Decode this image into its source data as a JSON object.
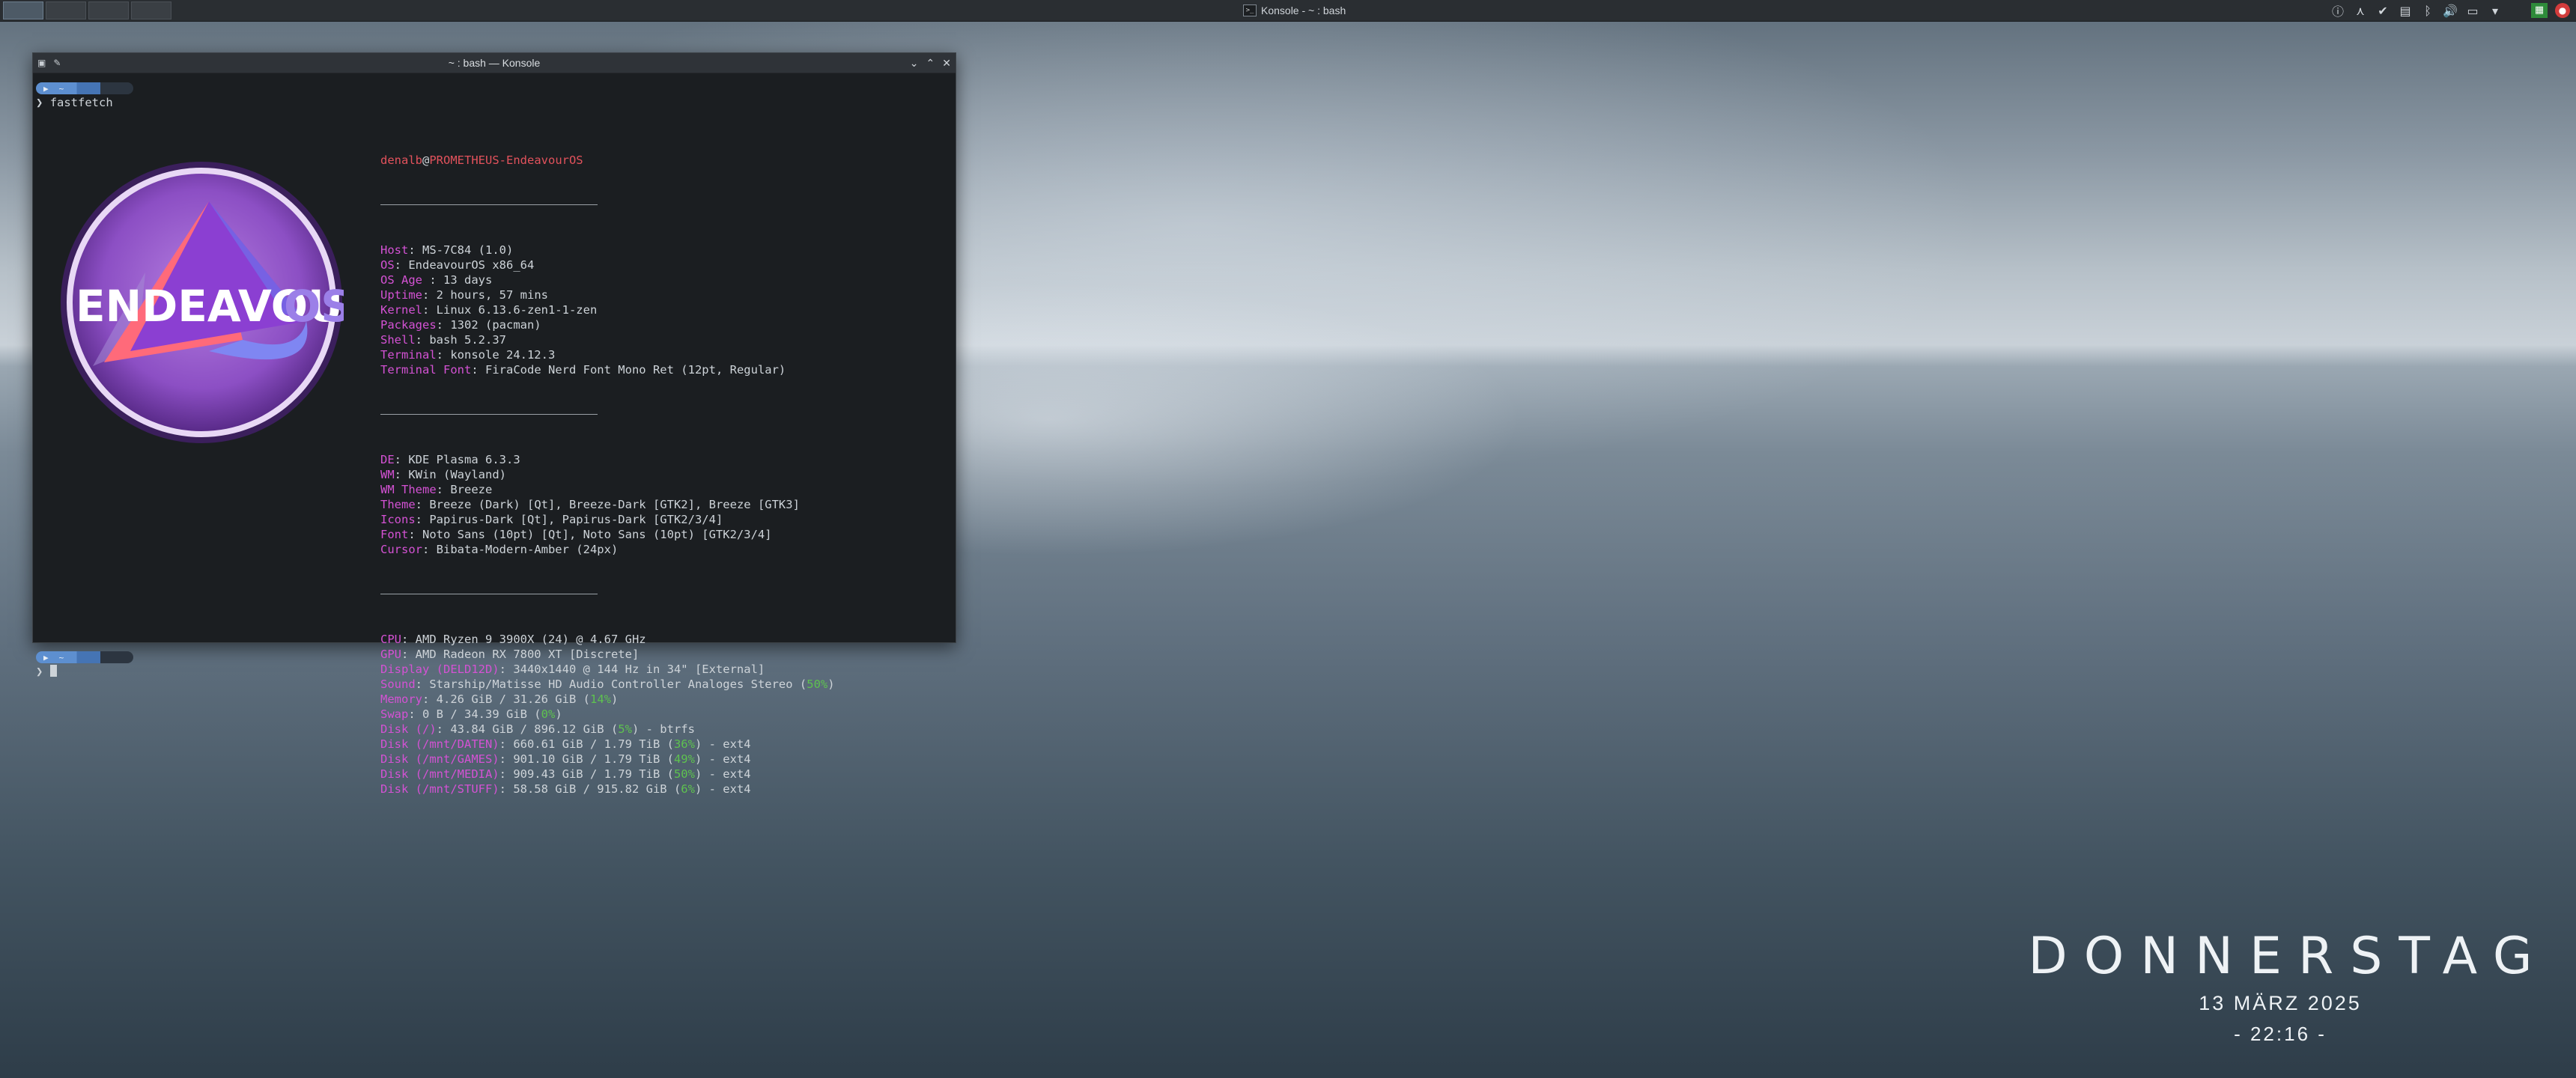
{
  "panel": {
    "task_title": "Konsole - ~ : bash",
    "task_icon": ">_"
  },
  "window": {
    "title": "~ : bash — Konsole",
    "min_icon": "⌄",
    "max_icon": "⌃",
    "close_icon": "✕"
  },
  "terminal": {
    "prompt_home": "~",
    "prompt_symbol": "❯",
    "command": "fastfetch",
    "logo_text_main": "ENDEAVOUR",
    "logo_text_os": "OS"
  },
  "fastfetch": {
    "user": "denalb",
    "at": "@",
    "host": "PROMETHEUS-EndeavourOS",
    "group1": [
      {
        "key": "Host",
        "value": "MS-7C84 (1.0)"
      },
      {
        "key": "OS",
        "value": "EndeavourOS x86_64"
      },
      {
        "key": "OS Age ",
        "value": "13 days"
      },
      {
        "key": "Uptime",
        "value": "2 hours, 57 mins"
      },
      {
        "key": "Kernel",
        "value": "Linux 6.13.6-zen1-1-zen"
      },
      {
        "key": "Packages",
        "value": "1302 (pacman)"
      },
      {
        "key": "Shell",
        "value": "bash 5.2.37"
      },
      {
        "key": "Terminal",
        "value": "konsole 24.12.3"
      },
      {
        "key": "Terminal Font",
        "value": "FiraCode Nerd Font Mono Ret (12pt, Regular)"
      }
    ],
    "group2": [
      {
        "key": "DE",
        "value": "KDE Plasma 6.3.3"
      },
      {
        "key": "WM",
        "value": "KWin (Wayland)"
      },
      {
        "key": "WM Theme",
        "value": "Breeze"
      },
      {
        "key": "Theme",
        "value": "Breeze (Dark) [Qt], Breeze-Dark [GTK2], Breeze [GTK3]"
      },
      {
        "key": "Icons",
        "value": "Papirus-Dark [Qt], Papirus-Dark [GTK2/3/4]"
      },
      {
        "key": "Font",
        "value": "Noto Sans (10pt) [Qt], Noto Sans (10pt) [GTK2/3/4]"
      },
      {
        "key": "Cursor",
        "value": "Bibata-Modern-Amber (24px)"
      }
    ],
    "group3": [
      {
        "key": "CPU",
        "value": "AMD Ryzen 9 3900X (24) @ 4.67 GHz"
      },
      {
        "key": "GPU",
        "value": "AMD Radeon RX 7800 XT [Discrete]"
      },
      {
        "key": "Display (DELD12D)",
        "value": "3440x1440 @ 144 Hz in 34\" [External]"
      },
      {
        "key": "Sound",
        "pre": "Starship/Matisse HD Audio Controller Analoges Stereo (",
        "pct": "50%",
        "post": ")"
      },
      {
        "key": "Memory",
        "pre": "4.26 GiB / 31.26 GiB (",
        "pct": "14%",
        "post": ")"
      },
      {
        "key": "Swap",
        "pre": "0 B / 34.39 GiB (",
        "pct": "0%",
        "post": ")"
      },
      {
        "key": "Disk (/)",
        "pre": "43.84 GiB / 896.12 GiB (",
        "pct": "5%",
        "post": ") - btrfs"
      },
      {
        "key": "Disk (/mnt/DATEN)",
        "pre": "660.61 GiB / 1.79 TiB (",
        "pct": "36%",
        "post": ") - ext4"
      },
      {
        "key": "Disk (/mnt/GAMES)",
        "pre": "901.10 GiB / 1.79 TiB (",
        "pct": "49%",
        "post": ") - ext4"
      },
      {
        "key": "Disk (/mnt/MEDIA)",
        "pre": "909.43 GiB / 1.79 TiB (",
        "pct": "50%",
        "post": ") - ext4"
      },
      {
        "key": "Disk (/mnt/STUFF)",
        "pre": "58.58 GiB / 915.82 GiB (",
        "pct": "6%",
        "post": ") - ext4"
      }
    ]
  },
  "clock": {
    "day": "DONNERSTAG",
    "date": "13 MÄRZ 2025",
    "time": "- 22:16 -"
  }
}
